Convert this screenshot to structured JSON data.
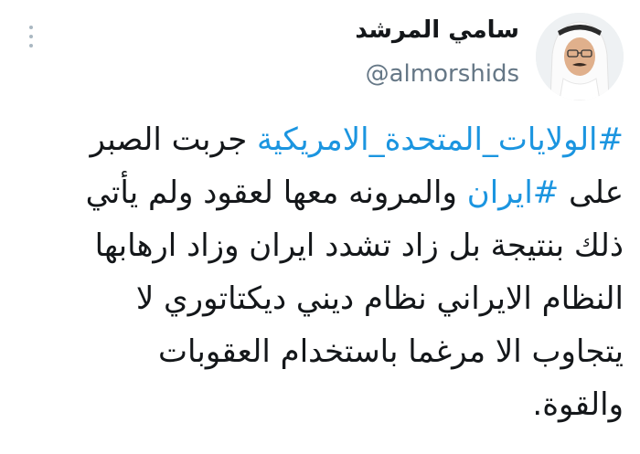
{
  "author": {
    "display_name": "سامي المرشد",
    "handle": "@almorshids"
  },
  "tweet": {
    "line1": {
      "hashtag": "#الولايات_المتحدة_الامريكية",
      "text": " جربت الصبر"
    },
    "line2": {
      "pre": "على ",
      "hashtag": "#ايران",
      "text": " والمرونه معها لعقود ولم يأتي"
    },
    "line3": "ذلك بنتيجة بل زاد تشدد ايران وزاد ارهابها",
    "line4": "النظام الايراني نظام ديني ديكتاتوري لا",
    "line5": "يتجاوب الا مرغما باستخدام العقوبات",
    "line6": "والقوة."
  },
  "colors": {
    "hashtag": "#1b95e0",
    "handle": "#657786",
    "text": "#14171a",
    "more_dots": "#aab8c2"
  },
  "icons": {
    "more": "more-vertical-icon",
    "avatar": "user-avatar"
  }
}
